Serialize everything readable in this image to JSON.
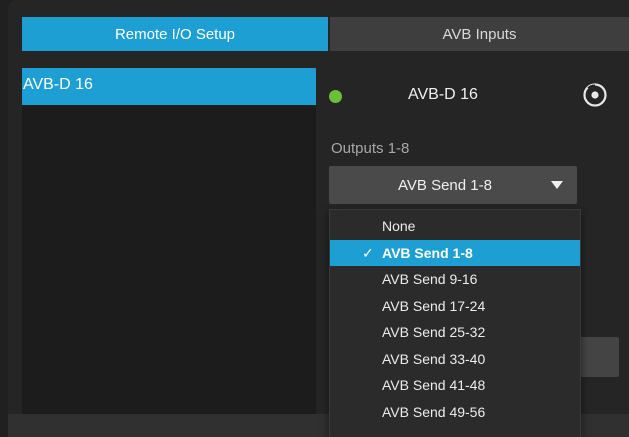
{
  "tabs": {
    "remote_setup": "Remote I/O Setup",
    "avb_inputs": "AVB Inputs"
  },
  "device_list": {
    "items": [
      "AVB-D 16"
    ]
  },
  "device_panel": {
    "title": "AVB-D 16",
    "status_color": "#6cbf3a",
    "outputs_label": "Outputs 1-8",
    "selected_value": "AVB Send 1-8"
  },
  "dropdown": {
    "check_mark": "✓",
    "options": [
      "None",
      "AVB Send 1-8",
      "AVB Send 9-16",
      "AVB Send 17-24",
      "AVB Send 25-32",
      "AVB Send 33-40",
      "AVB Send 41-48",
      "AVB Send 49-56"
    ]
  },
  "colors": {
    "accent": "#1e9fd4",
    "background": "#252525"
  }
}
